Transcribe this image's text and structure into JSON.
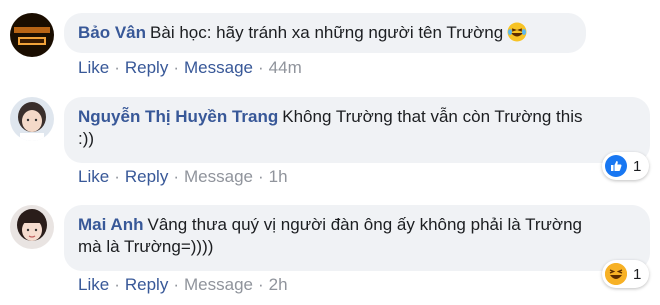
{
  "comments": [
    {
      "author": "Bảo Vân",
      "text": "Bài học: hãy tránh xa những người tên Trường",
      "inline_emoji": "laughing-tears-emoji",
      "actions": {
        "like": "Like",
        "reply": "Reply",
        "message": "Message",
        "time": "44m"
      }
    },
    {
      "author": "Nguyễn Thị Huyền Trang",
      "text_line1": "Không Trường that vẫn còn Trường this",
      "text_line2": ":))",
      "reaction": {
        "icon": "like-reaction-icon",
        "count": "1",
        "color": "#1877f2"
      },
      "actions": {
        "like": "Like",
        "reply": "Reply",
        "message": "Message",
        "time": "1h"
      }
    },
    {
      "author": "Mai Anh",
      "text_line1": "Vâng thưa quý vị người đàn ông ấy không phải là Trường",
      "text_line2": "mà là Trường=))))",
      "reaction": {
        "icon": "haha-reaction-icon",
        "count": "1",
        "color": "#f7b125"
      },
      "actions": {
        "like": "Like",
        "reply": "Reply",
        "message": "Message",
        "time": "2h"
      }
    }
  ],
  "colors": {
    "author": "#385898",
    "bubble": "#f0f2f5",
    "muted": "#90949c"
  }
}
